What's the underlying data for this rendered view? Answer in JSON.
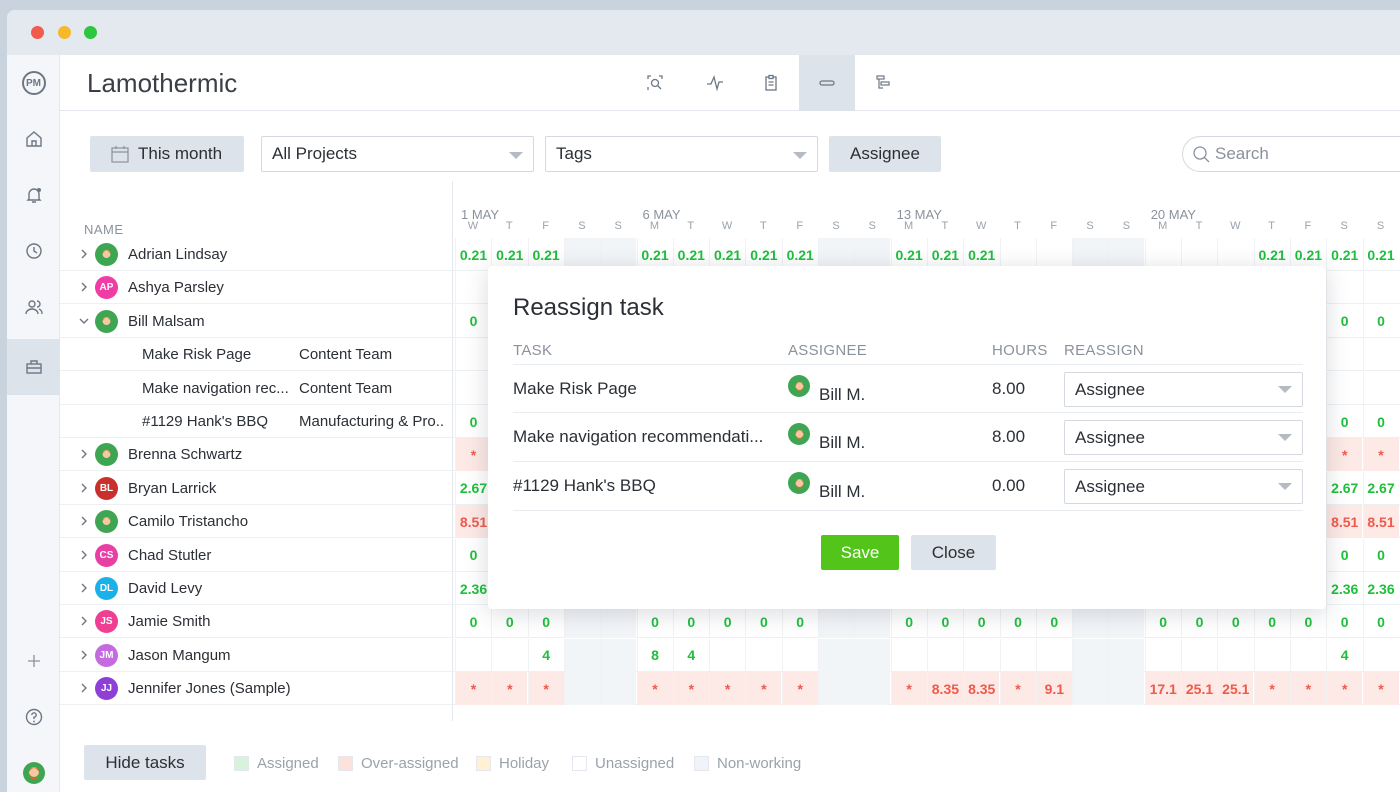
{
  "app": {
    "logo_text": "PM",
    "title": "Lamothermic"
  },
  "colors": {
    "assigned": "#1fbf3c",
    "over_assigned": "#f0594b",
    "save": "#52c41a"
  },
  "toolbar": {
    "views": [
      {
        "name": "search-view-icon"
      },
      {
        "name": "activity-icon"
      },
      {
        "name": "clipboard-icon"
      },
      {
        "name": "workload-icon"
      },
      {
        "name": "gantt-icon"
      }
    ]
  },
  "filters": {
    "date_label": "This month",
    "projects": "All Projects",
    "tags": "Tags",
    "assignee": "Assignee",
    "search_placeholder": "Search"
  },
  "grid": {
    "name_header": "NAME",
    "weeks": [
      "1 MAY",
      "6 MAY",
      "13 MAY",
      "20 MAY"
    ],
    "days": [
      "W",
      "T",
      "F",
      "S",
      "S",
      "M",
      "T",
      "W",
      "T",
      "F",
      "S",
      "S",
      "M",
      "T",
      "W",
      "T",
      "F",
      "S",
      "S",
      "M",
      "T",
      "W",
      "T",
      "F",
      "S",
      "S"
    ],
    "rows": [
      {
        "type": "user",
        "name": "Adrian Lindsay",
        "expanded": false,
        "initials": "",
        "cells": [
          "0.21",
          "0.21",
          "0.21",
          "",
          "",
          "0.21",
          "0.21",
          "0.21",
          "0.21",
          "0.21",
          "",
          "",
          "0.21",
          "0.21",
          "0.21",
          "",
          "",
          "",
          "",
          "",
          "",
          "",
          "0.21",
          "0.21",
          "0.21",
          "0.21"
        ]
      },
      {
        "type": "user",
        "name": "Ashya Parsley",
        "expanded": false,
        "initials": "AP",
        "cells": []
      },
      {
        "type": "user",
        "name": "Bill Malsam",
        "expanded": true,
        "initials": "",
        "cells": [
          "0",
          "",
          "",
          "",
          "",
          "",
          "",
          "",
          "",
          "",
          "",
          "",
          "",
          "",
          "",
          "",
          "",
          "",
          "",
          "",
          "",
          "",
          "",
          "",
          "0",
          "0"
        ]
      },
      {
        "type": "task",
        "name": "Make Risk Page",
        "project": "Content Team",
        "cells": []
      },
      {
        "type": "task",
        "name": "Make navigation rec...",
        "project": "Content Team",
        "cells": []
      },
      {
        "type": "task",
        "name": "#1129 Hank's BBQ",
        "project": "Manufacturing & Pro..",
        "cells": [
          "0",
          "",
          "",
          "",
          "",
          "",
          "",
          "",
          "",
          "",
          "",
          "",
          "",
          "",
          "",
          "",
          "",
          "",
          "",
          "",
          "",
          "",
          "",
          "",
          "0",
          "0"
        ]
      },
      {
        "type": "user",
        "name": "Brenna Schwartz",
        "expanded": false,
        "initials": "",
        "cells": [
          "*",
          "",
          "",
          "",
          "",
          "",
          "",
          "",
          "",
          "",
          "",
          "",
          "",
          "",
          "",
          "",
          "",
          "",
          "",
          "",
          "",
          "",
          "",
          "",
          "*",
          "*"
        ]
      },
      {
        "type": "user",
        "name": "Bryan Larrick",
        "expanded": false,
        "initials": "BL",
        "cells": [
          "2.67",
          "",
          "",
          "",
          "",
          "",
          "",
          "",
          "",
          "",
          "",
          "",
          "",
          "",
          "",
          "",
          "",
          "",
          "",
          "",
          "",
          "",
          "",
          "",
          "2.67",
          "2.67"
        ]
      },
      {
        "type": "user",
        "name": "Camilo Tristancho",
        "expanded": false,
        "initials": "",
        "cells": [
          "8.51",
          "",
          "",
          "",
          "",
          "",
          "",
          "",
          "",
          "",
          "",
          "",
          "",
          "",
          "",
          "",
          "",
          "",
          "",
          "",
          "",
          "",
          "",
          "",
          "8.51",
          "8.51"
        ]
      },
      {
        "type": "user",
        "name": "Chad Stutler",
        "expanded": false,
        "initials": "CS",
        "cells": [
          "0",
          "",
          "",
          "",
          "",
          "",
          "",
          "",
          "",
          "",
          "",
          "",
          "",
          "",
          "",
          "",
          "",
          "",
          "",
          "",
          "",
          "",
          "",
          "",
          "0",
          "0"
        ]
      },
      {
        "type": "user",
        "name": "David Levy",
        "expanded": false,
        "initials": "DL",
        "cells": [
          "2.36",
          "",
          "",
          "",
          "",
          "",
          "",
          "",
          "",
          "",
          "",
          "",
          "",
          "",
          "",
          "",
          "",
          "",
          "",
          "",
          "",
          "",
          "",
          "",
          "2.36",
          "2.36"
        ]
      },
      {
        "type": "user",
        "name": "Jamie Smith",
        "expanded": false,
        "initials": "JS",
        "cells": [
          "0",
          "0",
          "0",
          "",
          "",
          "0",
          "0",
          "0",
          "0",
          "0",
          "",
          "",
          "0",
          "0",
          "0",
          "0",
          "0",
          "",
          "",
          "0",
          "0",
          "0",
          "0",
          "0",
          "0",
          "0"
        ]
      },
      {
        "type": "user",
        "name": "Jason Mangum",
        "expanded": false,
        "initials": "JM",
        "cells": [
          "",
          "",
          "4",
          "",
          "",
          "8",
          "4",
          "",
          "",
          "",
          "",
          "",
          "",
          "",
          "",
          "",
          "",
          "",
          "",
          "",
          "",
          "",
          "",
          "",
          "4",
          ""
        ]
      },
      {
        "type": "user",
        "name": "Jennifer Jones (Sample)",
        "expanded": false,
        "initials": "JJ",
        "cells": [
          "*",
          "*",
          "*",
          "",
          "",
          "*",
          "*",
          "*",
          "*",
          "*",
          "",
          "",
          "*",
          "8.35",
          "8.35",
          "*",
          "9.1",
          "",
          "",
          "17.1",
          "25.1",
          "25.1",
          "*",
          "*",
          "*",
          "*"
        ]
      }
    ]
  },
  "footer": {
    "hide_tasks": "Hide tasks",
    "legend": [
      {
        "label": "Assigned",
        "color": "#d8f3dc"
      },
      {
        "label": "Over-assigned",
        "color": "#fde1db"
      },
      {
        "label": "Holiday",
        "color": "#fff1d2"
      },
      {
        "label": "Unassigned",
        "color": "#ffffff"
      },
      {
        "label": "Non-working",
        "color": "#f0f3f7"
      }
    ]
  },
  "modal": {
    "title": "Reassign task",
    "headers": {
      "task": "TASK",
      "assignee": "ASSIGNEE",
      "hours": "HOURS",
      "reassign": "REASSIGN"
    },
    "rows": [
      {
        "task": "Make Risk Page",
        "assignee": "Bill M.",
        "hours": "8.00",
        "reassign": "Assignee"
      },
      {
        "task": "Make navigation recommendati...",
        "assignee": "Bill M.",
        "hours": "8.00",
        "reassign": "Assignee"
      },
      {
        "task": "#1129 Hank's BBQ",
        "assignee": "Bill M.",
        "hours": "0.00",
        "reassign": "Assignee"
      }
    ],
    "save_label": "Save",
    "close_label": "Close"
  }
}
